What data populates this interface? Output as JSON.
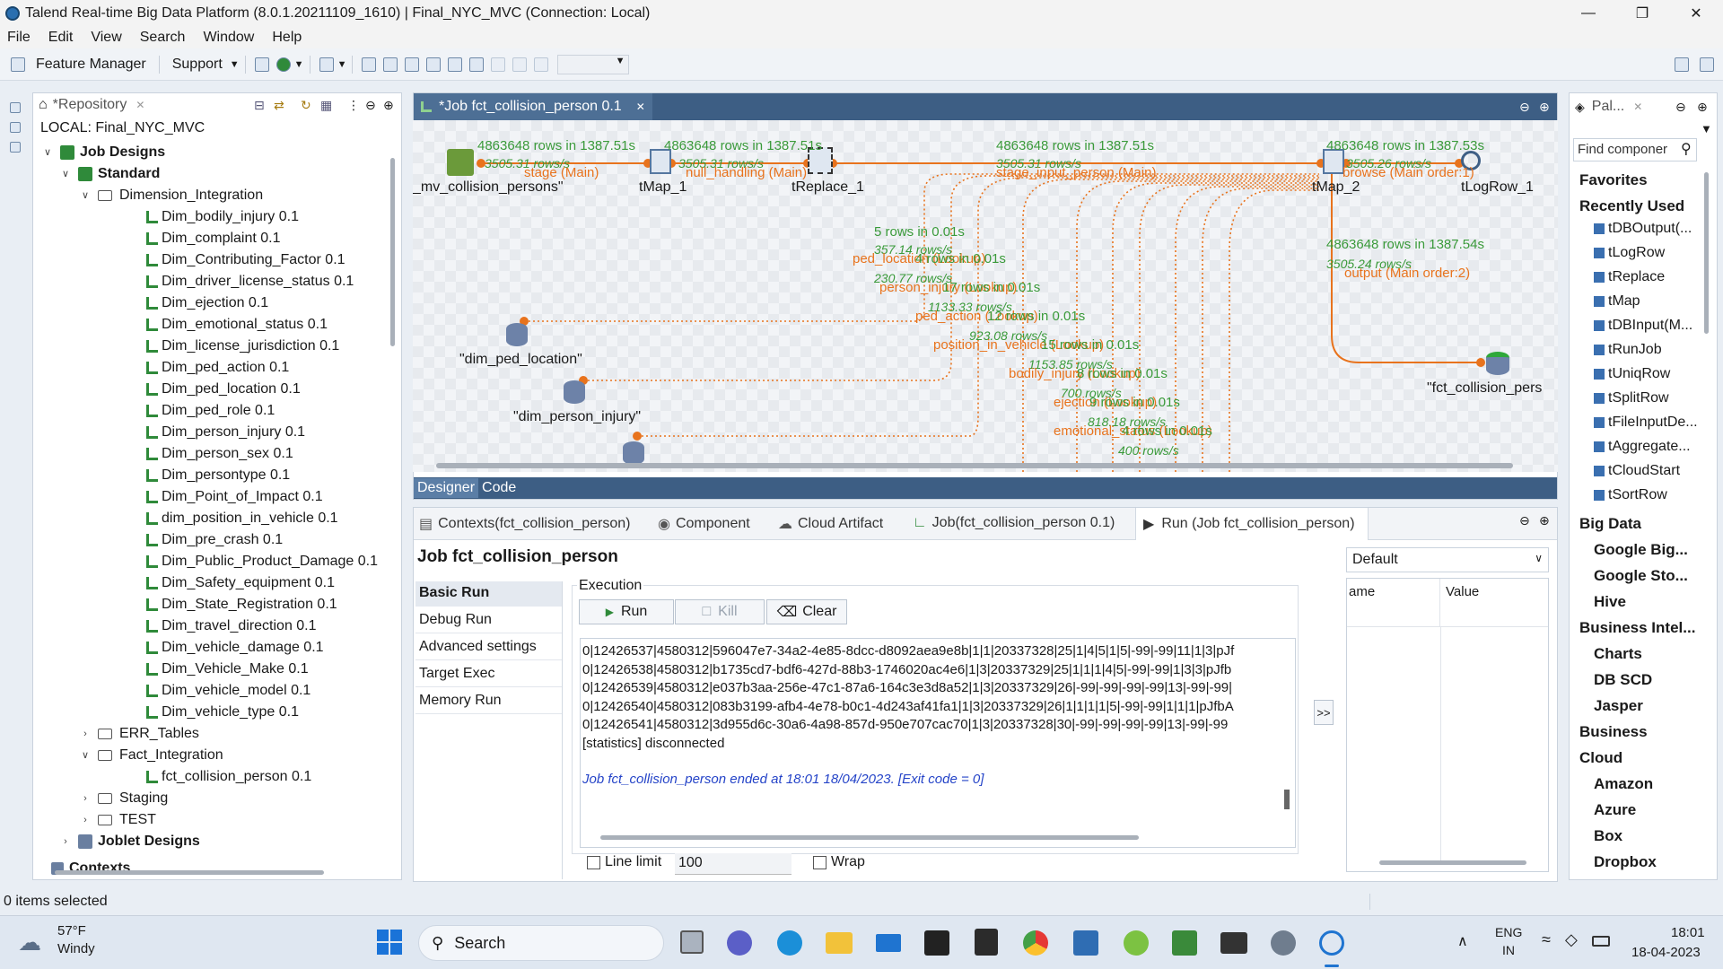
{
  "window": {
    "title": "Talend Real-time Big Data Platform (8.0.1.20211109_1610) | Final_NYC_MVC (Connection: Local)"
  },
  "menu": [
    "File",
    "Edit",
    "View",
    "Search",
    "Window",
    "Help"
  ],
  "toolbar": {
    "feature_manager": "Feature Manager",
    "support": "Support"
  },
  "repository": {
    "tab": "*Repository",
    "local": "LOCAL: Final_NYC_MVC",
    "job_designs": "Job Designs",
    "standard": "Standard",
    "dimension_integration": "Dimension_Integration",
    "dim_items": [
      "Dim_bodily_injury 0.1",
      "Dim_complaint 0.1",
      "Dim_Contributing_Factor 0.1",
      "Dim_driver_license_status 0.1",
      "Dim_ejection 0.1",
      "Dim_emotional_status 0.1",
      "Dim_license_jurisdiction 0.1",
      "Dim_ped_action 0.1",
      "Dim_ped_location 0.1",
      "Dim_ped_role 0.1",
      "Dim_person_injury 0.1",
      "Dim_person_sex 0.1",
      "Dim_persontype 0.1",
      "Dim_Point_of_Impact 0.1",
      "dim_position_in_vehicle 0.1",
      "Dim_pre_crash 0.1",
      "Dim_Public_Product_Damage 0.1",
      "Dim_Safety_equipment 0.1",
      "Dim_State_Registration 0.1",
      "Dim_travel_direction 0.1",
      "Dim_vehicle_damage 0.1",
      "Dim_Vehicle_Make 0.1",
      "Dim_vehicle_model 0.1",
      "Dim_vehicle_type 0.1"
    ],
    "err_tables": "ERR_Tables",
    "fact_integration": "Fact_Integration",
    "fact_job": "fct_collision_person 0.1",
    "staging": "Staging",
    "test": "TEST",
    "joblet_designs": "Joblet Designs",
    "contexts": "Contexts"
  },
  "editor": {
    "tab": "*Job fct_collision_person 0.1",
    "designer_tab": "Designer",
    "code_tab": "Code",
    "components": {
      "src": "_mv_collision_persons\"",
      "tmap1": "tMap_1",
      "treplace": "tReplace_1",
      "tmap2": "tMap_2",
      "tlogrow": "tLogRow_1",
      "ped_loc": "\"dim_ped_location\"",
      "person_injury": "\"dim_person_injury\"",
      "fact": "\"fct_collision_pers"
    },
    "flows": {
      "f1_rows": "4863648 rows in 1387.51s",
      "f1_rate": "3505.31 rows/s",
      "f1_name": "stage (Main)",
      "f2_rows": "4863648 rows in 1387.51s",
      "f2_rate": "3505.31 rows/s",
      "f2_name": "null_handling (Main)",
      "f3_rows": "4863648 rows in 1387.51s",
      "f3_rate": "3505.31 rows/s",
      "f3_name": "stage_input_person (Main)",
      "f4_rows": "4863648 rows in 1387.53s",
      "f4_rate": "3505.26 rows/s",
      "f4_name": "browse (Main order:1)",
      "f5_rows": "4863648 rows in 1387.54s",
      "f5_rate": "3505.24 rows/s",
      "f5_name": "output (Main order:2)",
      "l1_rows": "5 rows in 0.01s",
      "l1_rate": "357.14 rows/s",
      "l1_name": "ped_location (Lookup)",
      "l2_rows": "4 rows in 0.01s",
      "l2_rate": "230.77 rows/s",
      "l2_name": "person_injury (Lookup)",
      "l3_rows": "17 rows in 0.01s",
      "l3_rate": "1133.33 rows/s",
      "l3_name": "ped_action (Lookup)",
      "l4_rows": "12 rows in 0.01s",
      "l4_rate": "923.08 rows/s",
      "l4_name": "position_in_vehicle (Lookup)",
      "l5_rows": "15 rows in 0.01s",
      "l5_rate": "1153.85 rows/s",
      "l5_name": "bodily_injury (Lookup)",
      "l6_rows": "8 rows in 0.01s",
      "l6_rate": "700 rows/s",
      "l6_name": "ejection (Lookup)",
      "l7_rows": "9 rows in 0.01s",
      "l7_rate": "818.18 rows/s",
      "l7_name": "emotional_status (Lookup)",
      "l8_rows": "4 rows in 0.01s",
      "l8_rate": "400 rows/s"
    }
  },
  "bottom": {
    "tabs": [
      "Contexts(fct_collision_person)",
      "Component",
      "Cloud Artifact",
      "Job(fct_collision_person 0.1)",
      "Run (Job fct_collision_person)"
    ],
    "job_title": "Job fct_collision_person",
    "run_menu": [
      "Basic Run",
      "Debug Run",
      "Advanced settings",
      "Target Exec",
      "Memory Run"
    ],
    "execution": "Execution",
    "run": "Run",
    "kill": "Kill",
    "clear": "Clear",
    "console_lines": [
      "0|12426537|4580312|596047e7-34a2-4e85-8dcc-d8092aea9e8b|1|1|20337328|25|1|4|5|1|5|-99|-99|11|1|3|pJf",
      "0|12426538|4580312|b1735cd7-bdf6-427d-88b3-1746020ac4e6|1|3|20337329|25|1|1|1|4|5|-99|-99|1|3|3|pJfb",
      "0|12426539|4580312|e037b3aa-256e-47c1-87a6-164c3e3d8a52|1|3|20337329|26|-99|-99|-99|-99|13|-99|-99|",
      "0|12426540|4580312|083b3199-afb4-4e78-b0c1-4d243af41fa1|1|3|20337329|26|1|1|1|1|5|-99|-99|1|1|1|pJfbA",
      "0|12426541|4580312|3d955d6c-30a6-4a98-857d-950e707cac70|1|3|20337328|30|-99|-99|-99|-99|13|-99|-99",
      "[statistics] disconnected"
    ],
    "ended": "Job fct_collision_person ended at 18:01 18/04/2023. [Exit code  = 0]",
    "line_limit": "Line limit",
    "line_limit_value": "100",
    "wrap": "Wrap",
    "context_select": "Default",
    "col_name": "ame",
    "col_value": "Value",
    "arrow": ">>"
  },
  "palette": {
    "tab": "Pal...",
    "search_placeholder": "Find componer",
    "favorites": "Favorites",
    "recently_used": "Recently Used",
    "recent": [
      "tDBOutput(...",
      "tLogRow",
      "tReplace",
      "tMap",
      "tDBInput(M...",
      "tRunJob",
      "tUniqRow",
      "tSplitRow",
      "tFileInputDe...",
      "tAggregate...",
      "tCloudStart",
      "tSortRow"
    ],
    "big_data": "Big Data",
    "bd_items": [
      "Google Big...",
      "Google Sto...",
      "Hive"
    ],
    "business_intel": "Business Intel...",
    "bi_items": [
      "Charts",
      "DB SCD",
      "Jasper"
    ],
    "business": "Business",
    "cloud": "Cloud",
    "cloud_items": [
      "Amazon",
      "Azure",
      "Box",
      "Dropbox"
    ]
  },
  "status": {
    "selected": "0 items selected"
  },
  "taskbar": {
    "temp": "57°F",
    "weather": "Windy",
    "search": "Search",
    "lang1": "ENG",
    "lang2": "IN",
    "time": "18:01",
    "date": "18-04-2023"
  }
}
